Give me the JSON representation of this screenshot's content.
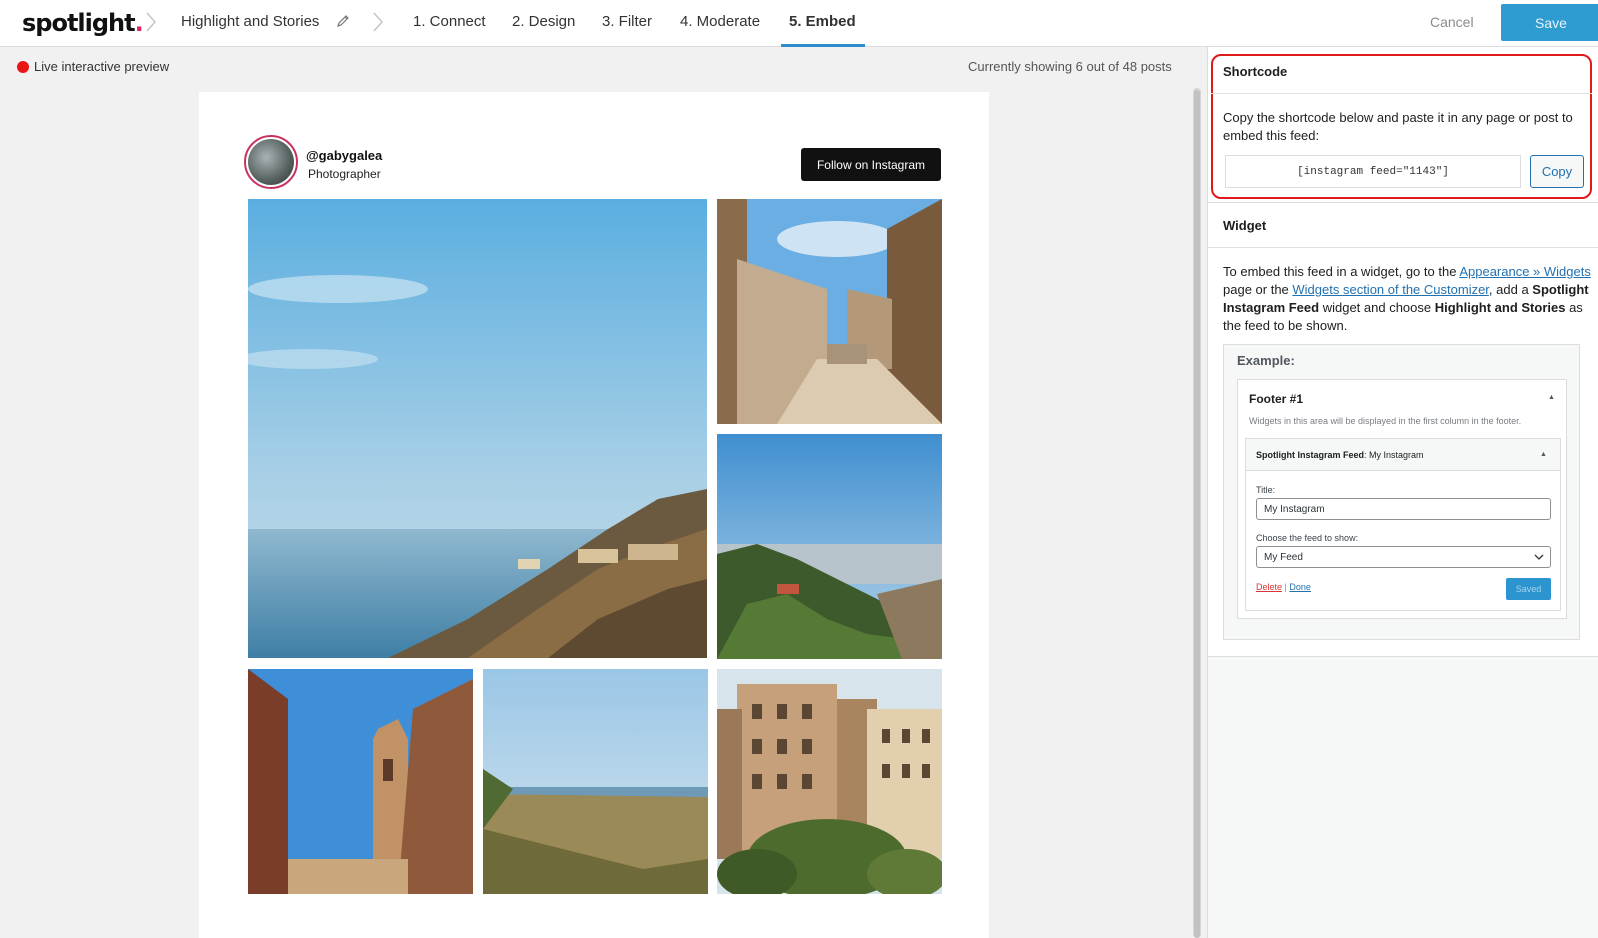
{
  "app": {
    "logo_text": "spotlight",
    "logo_dot": "."
  },
  "breadcrumb": {
    "feed_name": "Highlight and Stories"
  },
  "steps": [
    {
      "label": "1. Connect"
    },
    {
      "label": "2. Design"
    },
    {
      "label": "3. Filter"
    },
    {
      "label": "4. Moderate"
    },
    {
      "label": "5. Embed",
      "active": true
    }
  ],
  "toolbar": {
    "cancel_label": "Cancel",
    "save_label": "Save"
  },
  "preview": {
    "live_label": "Live interactive preview",
    "showing_label": "Currently showing 6 out of 48 posts"
  },
  "feed": {
    "username": "@gabygalea",
    "bio": "Photographer",
    "follow_label": "Follow on Instagram",
    "photos": [
      {
        "name": "coastal cliffs"
      },
      {
        "name": "stone staircase"
      },
      {
        "name": "city view from hill"
      },
      {
        "name": "cathedral tower"
      },
      {
        "name": "grassland by the sea"
      },
      {
        "name": "city buildings"
      }
    ]
  },
  "shortcode": {
    "title": "Shortcode",
    "description": "Copy the shortcode below and paste it in any page or post to embed this feed:",
    "value": "[instagram feed=\"1143\"]",
    "copy_label": "Copy"
  },
  "widget": {
    "title": "Widget",
    "text_1": "To embed this feed in a widget, go to the ",
    "link_appearance": "Appearance » Widgets",
    "text_2": " page or the ",
    "link_customizer": "Widgets section of the Customizer",
    "text_3": ", add a ",
    "bold_widget": "Spotlight Instagram Feed",
    "text_4": " widget and choose ",
    "bold_feed": "Highlight and Stories",
    "text_5": " as the feed to be shown.",
    "example": {
      "label": "Example:",
      "footer_title": "Footer #1",
      "footer_desc": "Widgets in this area will be displayed in the first column in the footer.",
      "widget_name": "Spotlight Instagram Feed",
      "widget_suffix": ": My Instagram",
      "title_label": "Title:",
      "title_value": "My Instagram",
      "feed_label": "Choose the feed to show:",
      "feed_value": "My Feed",
      "delete_label": "Delete",
      "separator": " | ",
      "done_label": "Done",
      "saved_label": "Saved"
    }
  },
  "colors": {
    "accent": "#2e9bd1",
    "live": "#e91616",
    "highlight": "#e01a1a"
  }
}
